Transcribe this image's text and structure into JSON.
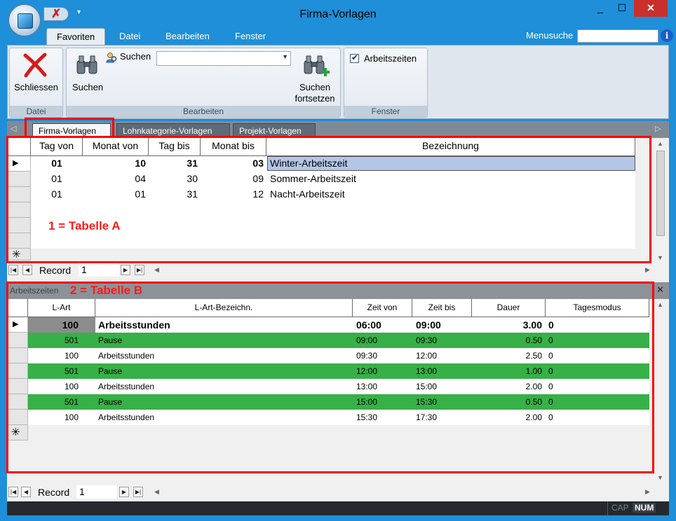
{
  "window": {
    "title": "Firma-Vorlagen",
    "minimize": "_",
    "maximize": "☐",
    "close": "✕",
    "quick_access_close": "✗",
    "quick_access_dropdown": "▾"
  },
  "ribbon": {
    "tabs": [
      "Favoriten",
      "Datei",
      "Bearbeiten",
      "Fenster"
    ],
    "active_tab": "Favoriten",
    "menusuche_label": "Menusuche",
    "menusuche_value": "",
    "info": "i",
    "groups": {
      "datei": {
        "label": "Datei",
        "schliessen": "Schliessen"
      },
      "bearbeiten": {
        "label": "Bearbeiten",
        "suchen_small": "Suchen",
        "suchen_combo": "",
        "suchen_big": "Suchen",
        "suchen_fortsetzen_1": "Suchen",
        "suchen_fortsetzen_2": "fortsetzen"
      },
      "fenster": {
        "label": "Fenster",
        "arbeitszeiten": "Arbeitszeiten",
        "arbeitszeiten_checked": true
      }
    }
  },
  "doc_tabs": [
    "Firma-Vorlagen",
    "Lohnkategorie-Vorlagen",
    "Projekt-Vorlagen"
  ],
  "active_doc_tab": "Firma-Vorlagen",
  "table_a": {
    "columns": [
      "Tag von",
      "Monat von",
      "Tag bis",
      "Monat bis",
      "Bezeichnung"
    ],
    "rows": [
      {
        "tag_von": "01",
        "monat_von": "10",
        "tag_bis": "31",
        "monat_bis": "03",
        "bezeichnung": "Winter-Arbeitszeit"
      },
      {
        "tag_von": "01",
        "monat_von": "04",
        "tag_bis": "30",
        "monat_bis": "09",
        "bezeichnung": "Sommer-Arbeitszeit"
      },
      {
        "tag_von": "01",
        "monat_von": "01",
        "tag_bis": "31",
        "monat_bis": "12",
        "bezeichnung": "Nacht-Arbeitszeit"
      }
    ],
    "annotation": "1 = Tabelle A",
    "record_label": "Record",
    "record_value": "1"
  },
  "table_b": {
    "subheader": "Arbeitszeiten",
    "close": "✕",
    "annotation": "2 = Tabelle B",
    "columns": [
      "L-Art",
      "L-Art-Bezeichn.",
      "Zeit von",
      "Zeit bis",
      "Dauer",
      "Tagesmodus"
    ],
    "rows": [
      {
        "lart": "100",
        "bez": "Arbeitsstunden",
        "von": "06:00",
        "bis": "09:00",
        "dauer": "3.00",
        "modus": "0",
        "green": false
      },
      {
        "lart": "501",
        "bez": "Pause",
        "von": "09:00",
        "bis": "09:30",
        "dauer": "0.50",
        "modus": "0",
        "green": true
      },
      {
        "lart": "100",
        "bez": "Arbeitsstunden",
        "von": "09:30",
        "bis": "12:00",
        "dauer": "2.50",
        "modus": "0",
        "green": false
      },
      {
        "lart": "501",
        "bez": "Pause",
        "von": "12:00",
        "bis": "13:00",
        "dauer": "1.00",
        "modus": "0",
        "green": true
      },
      {
        "lart": "100",
        "bez": "Arbeitsstunden",
        "von": "13:00",
        "bis": "15:00",
        "dauer": "2.00",
        "modus": "0",
        "green": false
      },
      {
        "lart": "501",
        "bez": "Pause",
        "von": "15:00",
        "bis": "15:30",
        "dauer": "0.50",
        "modus": "0",
        "green": true
      },
      {
        "lart": "100",
        "bez": "Arbeitsstunden",
        "von": "15:30",
        "bis": "17:30",
        "dauer": "2.00",
        "modus": "0",
        "green": false
      }
    ],
    "record_label": "Record",
    "record_value": "1"
  },
  "statusbar": {
    "cap": "CAP",
    "num": "NUM"
  },
  "colors": {
    "frame": "#1E8FD8",
    "green_row": "#37B047",
    "selected_cell": "#B4C6E7",
    "annotation_red": "#FF0000"
  }
}
